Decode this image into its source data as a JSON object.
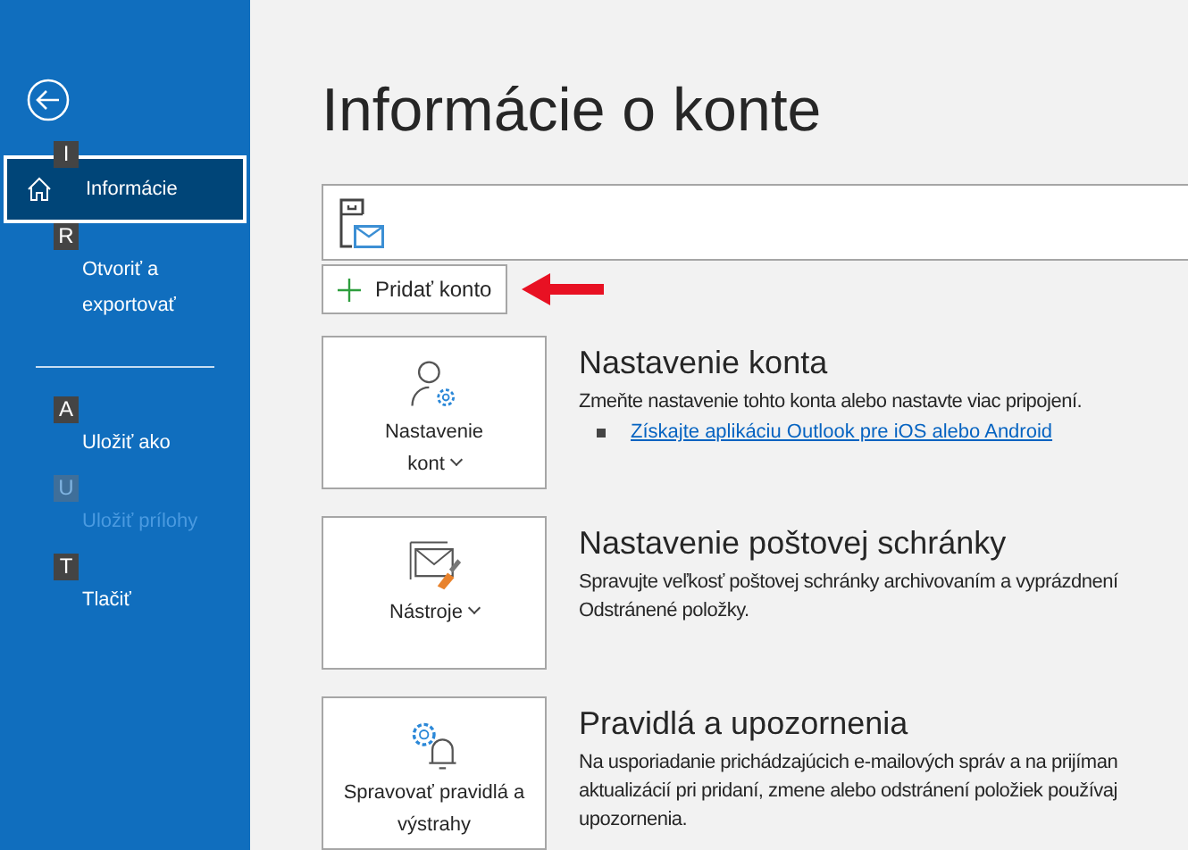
{
  "sidebar": {
    "items": [
      {
        "kind": "item",
        "keytip": "I",
        "label": "Informácie",
        "selected": true,
        "disabled": false
      },
      {
        "kind": "item",
        "keytip": "R",
        "label": "Otvoriť a exportovať",
        "selected": false,
        "disabled": false
      },
      {
        "kind": "divider"
      },
      {
        "kind": "item",
        "keytip": "A",
        "label": "Uložiť ako",
        "selected": false,
        "disabled": false
      },
      {
        "kind": "item",
        "keytip": "U",
        "label": "Uložiť prílohy",
        "selected": false,
        "disabled": true
      },
      {
        "kind": "item",
        "keytip": "T",
        "label": "Tlačiť",
        "selected": false,
        "disabled": false
      }
    ]
  },
  "page_title": "Informácie o konte",
  "add_account_button": "Pridať konto",
  "sections": [
    {
      "button": "Nastavenie kont",
      "dropdown": true,
      "title": "Nastavenie konta",
      "description": [
        "Zmeňte nastavenie tohto konta alebo nastavte viac pripojení."
      ],
      "link": "Získajte aplikáciu Outlook pre iOS alebo Android"
    },
    {
      "button": "Nástroje",
      "dropdown": true,
      "title": "Nastavenie poštovej schránky",
      "description": [
        "Spravujte veľkosť poštovej schránky archivovaním a vyprázdnení",
        "Odstránené položky."
      ]
    },
    {
      "button": "Spravovať pravidlá a výstrahy",
      "dropdown": false,
      "title": "Pravidlá a upozornenia",
      "description": [
        "Na usporiadanie prichádzajúcich e-mailových správ a na prijíman",
        "aktualizácií pri pridaní, zmene alebo odstránení položiek používaj",
        "upozornenia."
      ]
    }
  ]
}
